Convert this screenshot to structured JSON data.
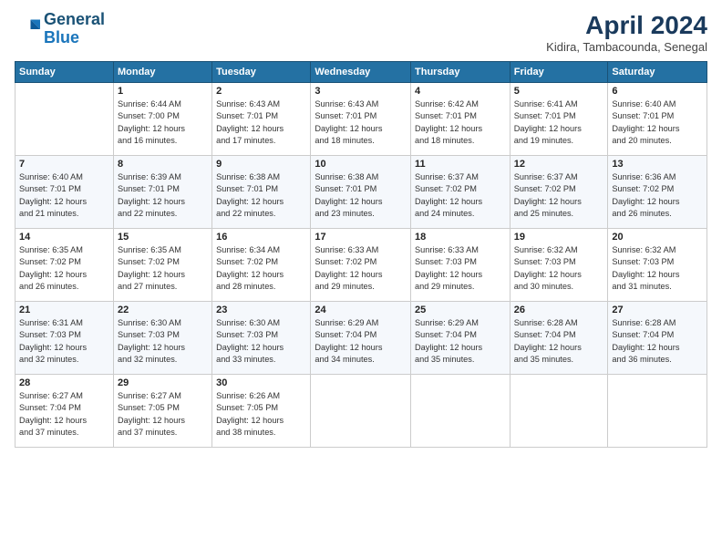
{
  "logo": {
    "line1": "General",
    "line2": "Blue"
  },
  "header": {
    "title": "April 2024",
    "location": "Kidira, Tambacounda, Senegal"
  },
  "columns": [
    "Sunday",
    "Monday",
    "Tuesday",
    "Wednesday",
    "Thursday",
    "Friday",
    "Saturday"
  ],
  "weeks": [
    [
      {
        "day": "",
        "info": ""
      },
      {
        "day": "1",
        "info": "Sunrise: 6:44 AM\nSunset: 7:00 PM\nDaylight: 12 hours\nand 16 minutes."
      },
      {
        "day": "2",
        "info": "Sunrise: 6:43 AM\nSunset: 7:01 PM\nDaylight: 12 hours\nand 17 minutes."
      },
      {
        "day": "3",
        "info": "Sunrise: 6:43 AM\nSunset: 7:01 PM\nDaylight: 12 hours\nand 18 minutes."
      },
      {
        "day": "4",
        "info": "Sunrise: 6:42 AM\nSunset: 7:01 PM\nDaylight: 12 hours\nand 18 minutes."
      },
      {
        "day": "5",
        "info": "Sunrise: 6:41 AM\nSunset: 7:01 PM\nDaylight: 12 hours\nand 19 minutes."
      },
      {
        "day": "6",
        "info": "Sunrise: 6:40 AM\nSunset: 7:01 PM\nDaylight: 12 hours\nand 20 minutes."
      }
    ],
    [
      {
        "day": "7",
        "info": "Sunrise: 6:40 AM\nSunset: 7:01 PM\nDaylight: 12 hours\nand 21 minutes."
      },
      {
        "day": "8",
        "info": "Sunrise: 6:39 AM\nSunset: 7:01 PM\nDaylight: 12 hours\nand 22 minutes."
      },
      {
        "day": "9",
        "info": "Sunrise: 6:38 AM\nSunset: 7:01 PM\nDaylight: 12 hours\nand 22 minutes."
      },
      {
        "day": "10",
        "info": "Sunrise: 6:38 AM\nSunset: 7:01 PM\nDaylight: 12 hours\nand 23 minutes."
      },
      {
        "day": "11",
        "info": "Sunrise: 6:37 AM\nSunset: 7:02 PM\nDaylight: 12 hours\nand 24 minutes."
      },
      {
        "day": "12",
        "info": "Sunrise: 6:37 AM\nSunset: 7:02 PM\nDaylight: 12 hours\nand 25 minutes."
      },
      {
        "day": "13",
        "info": "Sunrise: 6:36 AM\nSunset: 7:02 PM\nDaylight: 12 hours\nand 26 minutes."
      }
    ],
    [
      {
        "day": "14",
        "info": "Sunrise: 6:35 AM\nSunset: 7:02 PM\nDaylight: 12 hours\nand 26 minutes."
      },
      {
        "day": "15",
        "info": "Sunrise: 6:35 AM\nSunset: 7:02 PM\nDaylight: 12 hours\nand 27 minutes."
      },
      {
        "day": "16",
        "info": "Sunrise: 6:34 AM\nSunset: 7:02 PM\nDaylight: 12 hours\nand 28 minutes."
      },
      {
        "day": "17",
        "info": "Sunrise: 6:33 AM\nSunset: 7:02 PM\nDaylight: 12 hours\nand 29 minutes."
      },
      {
        "day": "18",
        "info": "Sunrise: 6:33 AM\nSunset: 7:03 PM\nDaylight: 12 hours\nand 29 minutes."
      },
      {
        "day": "19",
        "info": "Sunrise: 6:32 AM\nSunset: 7:03 PM\nDaylight: 12 hours\nand 30 minutes."
      },
      {
        "day": "20",
        "info": "Sunrise: 6:32 AM\nSunset: 7:03 PM\nDaylight: 12 hours\nand 31 minutes."
      }
    ],
    [
      {
        "day": "21",
        "info": "Sunrise: 6:31 AM\nSunset: 7:03 PM\nDaylight: 12 hours\nand 32 minutes."
      },
      {
        "day": "22",
        "info": "Sunrise: 6:30 AM\nSunset: 7:03 PM\nDaylight: 12 hours\nand 32 minutes."
      },
      {
        "day": "23",
        "info": "Sunrise: 6:30 AM\nSunset: 7:03 PM\nDaylight: 12 hours\nand 33 minutes."
      },
      {
        "day": "24",
        "info": "Sunrise: 6:29 AM\nSunset: 7:04 PM\nDaylight: 12 hours\nand 34 minutes."
      },
      {
        "day": "25",
        "info": "Sunrise: 6:29 AM\nSunset: 7:04 PM\nDaylight: 12 hours\nand 35 minutes."
      },
      {
        "day": "26",
        "info": "Sunrise: 6:28 AM\nSunset: 7:04 PM\nDaylight: 12 hours\nand 35 minutes."
      },
      {
        "day": "27",
        "info": "Sunrise: 6:28 AM\nSunset: 7:04 PM\nDaylight: 12 hours\nand 36 minutes."
      }
    ],
    [
      {
        "day": "28",
        "info": "Sunrise: 6:27 AM\nSunset: 7:04 PM\nDaylight: 12 hours\nand 37 minutes."
      },
      {
        "day": "29",
        "info": "Sunrise: 6:27 AM\nSunset: 7:05 PM\nDaylight: 12 hours\nand 37 minutes."
      },
      {
        "day": "30",
        "info": "Sunrise: 6:26 AM\nSunset: 7:05 PM\nDaylight: 12 hours\nand 38 minutes."
      },
      {
        "day": "",
        "info": ""
      },
      {
        "day": "",
        "info": ""
      },
      {
        "day": "",
        "info": ""
      },
      {
        "day": "",
        "info": ""
      }
    ]
  ]
}
